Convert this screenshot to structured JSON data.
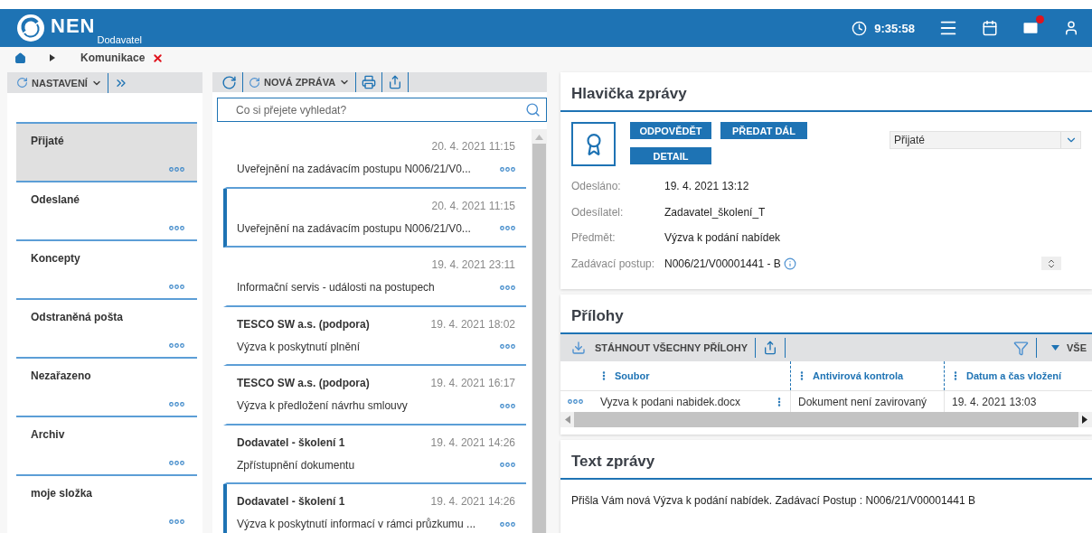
{
  "header": {
    "app": "NEN",
    "role": "Dodavatel",
    "time": "9:35:58",
    "mail_badge": true
  },
  "breadcrumb": {
    "items": [
      "Komunikace"
    ]
  },
  "folders_toolbar": {
    "label": "NASTAVENÍ"
  },
  "folders": [
    {
      "name": "Přijaté",
      "selected": true
    },
    {
      "name": "Odeslané",
      "selected": false
    },
    {
      "name": "Koncepty",
      "selected": false
    },
    {
      "name": "Odstraněná pošta",
      "selected": false
    },
    {
      "name": "Nezařazeno",
      "selected": false
    },
    {
      "name": "Archiv",
      "selected": false
    },
    {
      "name": "moje složka",
      "selected": false
    }
  ],
  "messages_toolbar": {
    "new_label": "NOVÁ ZPRÁVA"
  },
  "search": {
    "placeholder": "Co si přejete vyhledat?"
  },
  "messages": [
    {
      "date": "20. 4. 2021 11:15",
      "subject": "Uveřejnění na zadávacím postupu N006/21/V0...",
      "unread": false
    },
    {
      "date": "20. 4. 2021 11:15",
      "subject": "Uveřejnění na zadávacím postupu N006/21/V0...",
      "unread": true
    },
    {
      "date": "19. 4. 2021 23:11",
      "subject": "Informační servis - události na postupech",
      "unread": false
    },
    {
      "sender": "TESCO SW a.s. (podpora)",
      "date": "19. 4. 2021 18:02",
      "subject": "Výzva k poskytnutí plnění",
      "unread": false
    },
    {
      "sender": "TESCO SW a.s. (podpora)",
      "date": "19. 4. 2021 16:17",
      "subject": "Výzva k předložení návrhu smlouvy",
      "unread": false
    },
    {
      "sender": "Dodavatel - školení 1",
      "date": "19. 4. 2021 14:26",
      "subject": "Zpřístupnění dokumentu",
      "unread": false
    },
    {
      "sender": "Dodavatel - školení 1",
      "date": "19. 4. 2021 14:26",
      "subject": "Výzva k poskytnutí informací v rámci průzkumu ...",
      "unread": true
    }
  ],
  "detail": {
    "title": "Hlavička zprávy",
    "buttons": [
      "ODPOVĚDĚT",
      "PŘEDAT DÁL",
      "DETAIL"
    ],
    "folder_select": "Přijaté",
    "fields": [
      {
        "kind": "text",
        "label": "Odesláno:",
        "value": "19. 4. 2021 13:12"
      },
      {
        "kind": "text",
        "label": "Odesílatel:",
        "value": "Zadavatel_školení_T"
      },
      {
        "kind": "text",
        "label": "Předmět:",
        "value": "Výzva k podání nabídek"
      },
      {
        "kind": "procedure",
        "label": "Zadávací postup:",
        "value": "N006/21/V00001441 - B"
      }
    ]
  },
  "attachments": {
    "title": "Přílohy",
    "download_label": "STÁHNOUT VŠECHNY PŘÍLOHY",
    "filter_label": "VŠE",
    "columns": [
      "Soubor",
      "Antivirová kontrola",
      "Datum a čas vložení"
    ],
    "rows": [
      {
        "cells": [
          "Vyzva k podani nabidek.docx",
          "Dokument není zavirovaný",
          "19. 4. 2021 13:03"
        ]
      }
    ]
  },
  "message_text": {
    "title": "Text zprávy",
    "body": "Přišla Vám nová Výzva k podání nabídek. Zadávací Postup : N006/21/V00001441 B"
  }
}
